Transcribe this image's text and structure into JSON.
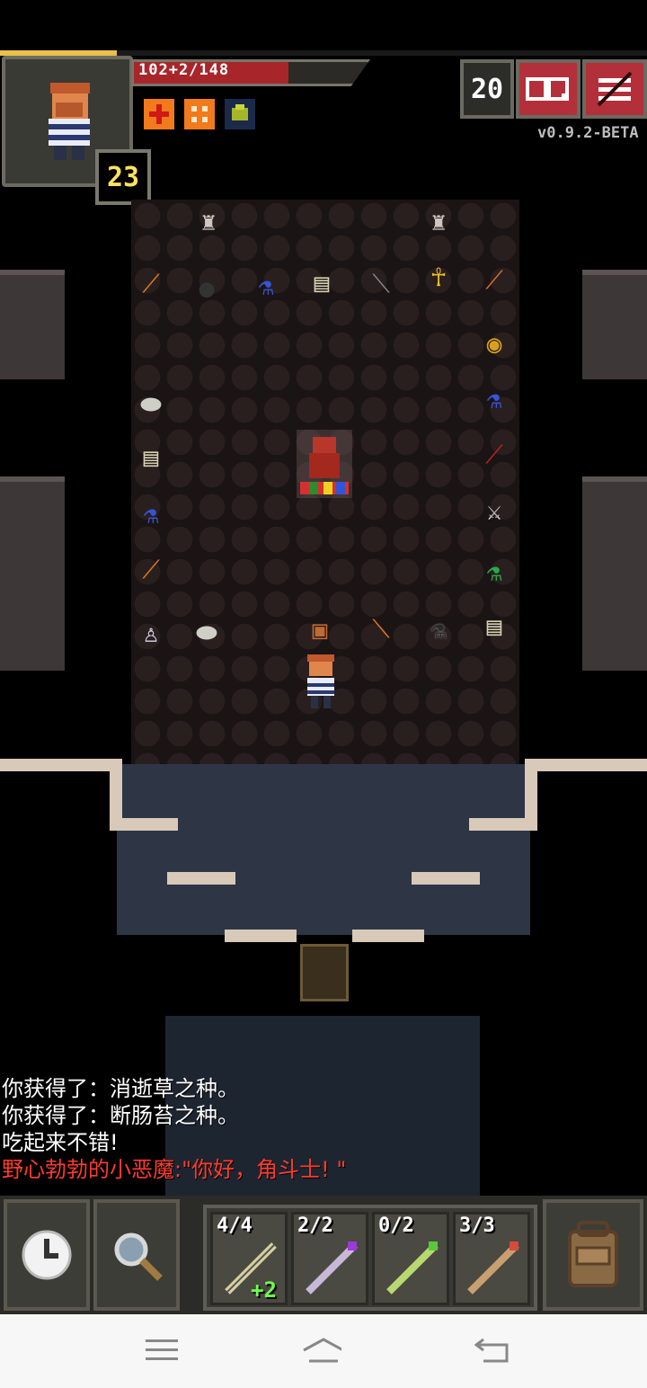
{
  "status": {
    "hp_text": "102+2/148",
    "hp_fraction": 0.69,
    "xp_fraction": 0.18,
    "level": "23",
    "depth": "20",
    "version": "v0.9.2-BETA",
    "buffs": [
      "heal-buff-icon",
      "shield-buff-icon",
      "ooze-debuff-icon"
    ]
  },
  "top_buttons": {
    "journal_icon": "journal-icon",
    "menu_icon": "menu-icon"
  },
  "room_items": [
    {
      "name": "torch"
    },
    {
      "name": "bomb"
    },
    {
      "name": "potion-blue"
    },
    {
      "name": "scroll"
    },
    {
      "name": "wand"
    },
    {
      "name": "ankh"
    },
    {
      "name": "trident"
    },
    {
      "name": "honeypot"
    },
    {
      "name": "stone"
    },
    {
      "name": "tombstone"
    },
    {
      "name": "potion-blue"
    },
    {
      "name": "sword"
    },
    {
      "name": "potion-green"
    },
    {
      "name": "armor"
    },
    {
      "name": "torch"
    },
    {
      "name": "chest"
    },
    {
      "name": "potion-black"
    },
    {
      "name": "scroll"
    }
  ],
  "log": [
    {
      "text": "你获得了：消逝草之种。",
      "color": "#ffffff"
    },
    {
      "text": "你获得了：断肠苔之种。",
      "color": "#ffffff"
    },
    {
      "text": "吃起来不错!",
      "color": "#ffffff"
    },
    {
      "text": "野心勃勃的小恶魔:\"你好，角斗士! \"",
      "color": "#ff3b2f"
    }
  ],
  "toolbar": {
    "wait_icon": "clock-icon",
    "search_icon": "magnifier-icon",
    "backpack_icon": "backpack-icon",
    "quickslots": [
      {
        "label": "4/4",
        "bonus": "+2"
      },
      {
        "label": "2/2",
        "bonus": ""
      },
      {
        "label": "0/2",
        "bonus": ""
      },
      {
        "label": "3/3",
        "bonus": ""
      }
    ]
  },
  "navbar": {
    "menu_icon": "menu-lines-icon",
    "home_icon": "home-icon",
    "back_icon": "back-icon"
  }
}
